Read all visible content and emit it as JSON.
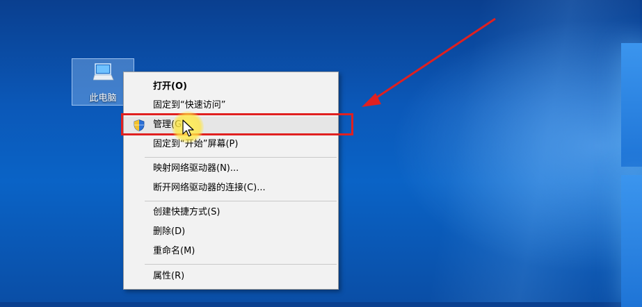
{
  "desktop": {
    "icon_label": "此电脑",
    "icon_name": "computer-icon"
  },
  "context_menu": {
    "items": [
      {
        "label": "打开(O)",
        "bold": true
      },
      {
        "label": "固定到“快速访问”"
      },
      {
        "label": "管理(G)",
        "icon": "shield-icon"
      },
      {
        "label": "固定到“开始”屏幕(P)"
      },
      {
        "label": "映射网络驱动器(N)..."
      },
      {
        "label": "断开网络驱动器的连接(C)..."
      },
      {
        "label": "创建快捷方式(S)"
      },
      {
        "label": "删除(D)"
      },
      {
        "label": "重命名(M)"
      },
      {
        "label": "属性(R)"
      }
    ]
  },
  "annotation": {
    "highlight_color": "#e02020",
    "arrow_color": "#e02020",
    "cursor_halo_color": "#ffe83a"
  },
  "colors": {
    "desktop_blue": "#0b58b8",
    "menu_background": "#f2f2f2"
  }
}
